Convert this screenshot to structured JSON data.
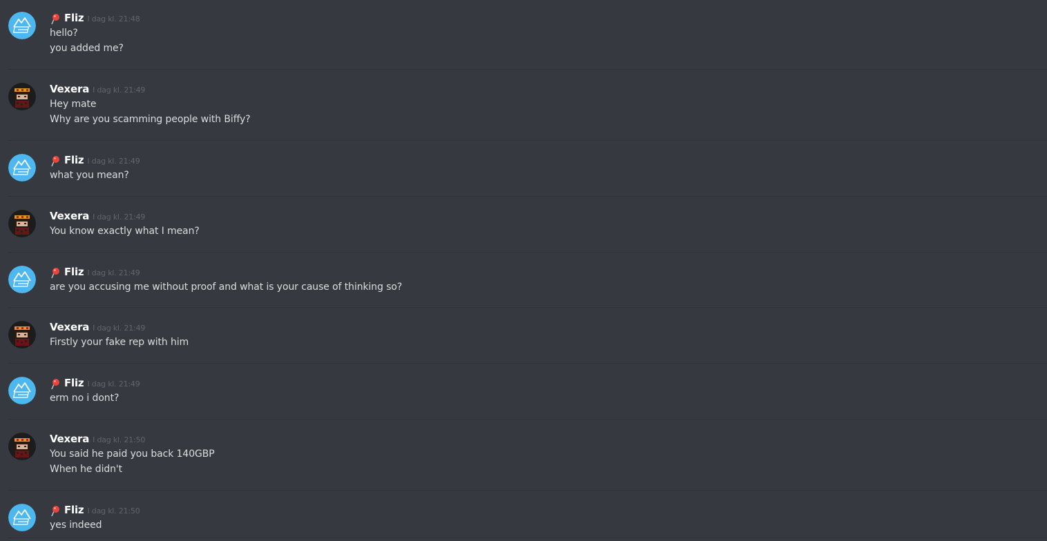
{
  "messages": [
    {
      "author": "Fliz",
      "has_badge": true,
      "timestamp": "I dag kl. 21:48",
      "lines": [
        "hello?",
        "you added me?"
      ]
    },
    {
      "author": "Vexera",
      "has_badge": false,
      "timestamp": "I dag kl. 21:49",
      "lines": [
        "Hey mate",
        "Why are you scamming people with Biffy?"
      ]
    },
    {
      "author": "Fliz",
      "has_badge": true,
      "timestamp": "I dag kl. 21:49",
      "lines": [
        "what you mean?"
      ]
    },
    {
      "author": "Vexera",
      "has_badge": false,
      "timestamp": "I dag kl. 21:49",
      "lines": [
        "You know exactly what I mean?"
      ]
    },
    {
      "author": "Fliz",
      "has_badge": true,
      "timestamp": "I dag kl. 21:49",
      "lines": [
        "are you accusing me without proof and what is your cause of thinking so?"
      ]
    },
    {
      "author": "Vexera",
      "has_badge": false,
      "timestamp": "I dag kl. 21:49",
      "lines": [
        "Firstly your fake rep with him"
      ]
    },
    {
      "author": "Fliz",
      "has_badge": true,
      "timestamp": "I dag kl. 21:49",
      "lines": [
        "erm no i dont?"
      ]
    },
    {
      "author": "Vexera",
      "has_badge": false,
      "timestamp": "I dag kl. 21:50",
      "lines": [
        "You said he paid you back 140GBP",
        "When he didn't"
      ]
    },
    {
      "author": "Fliz",
      "has_badge": true,
      "timestamp": "I dag kl. 21:50",
      "lines": [
        "yes indeed"
      ]
    }
  ],
  "colors": {
    "background": "#36393f",
    "divider": "#2f3237",
    "fliz_avatar": "#4db8f0",
    "badge_pin": "#e8453c"
  },
  "icons": {
    "fliz_avatar": "mountain-logo-icon",
    "vexera_avatar": "pixel-character-icon",
    "badge": "red-pin-icon"
  }
}
